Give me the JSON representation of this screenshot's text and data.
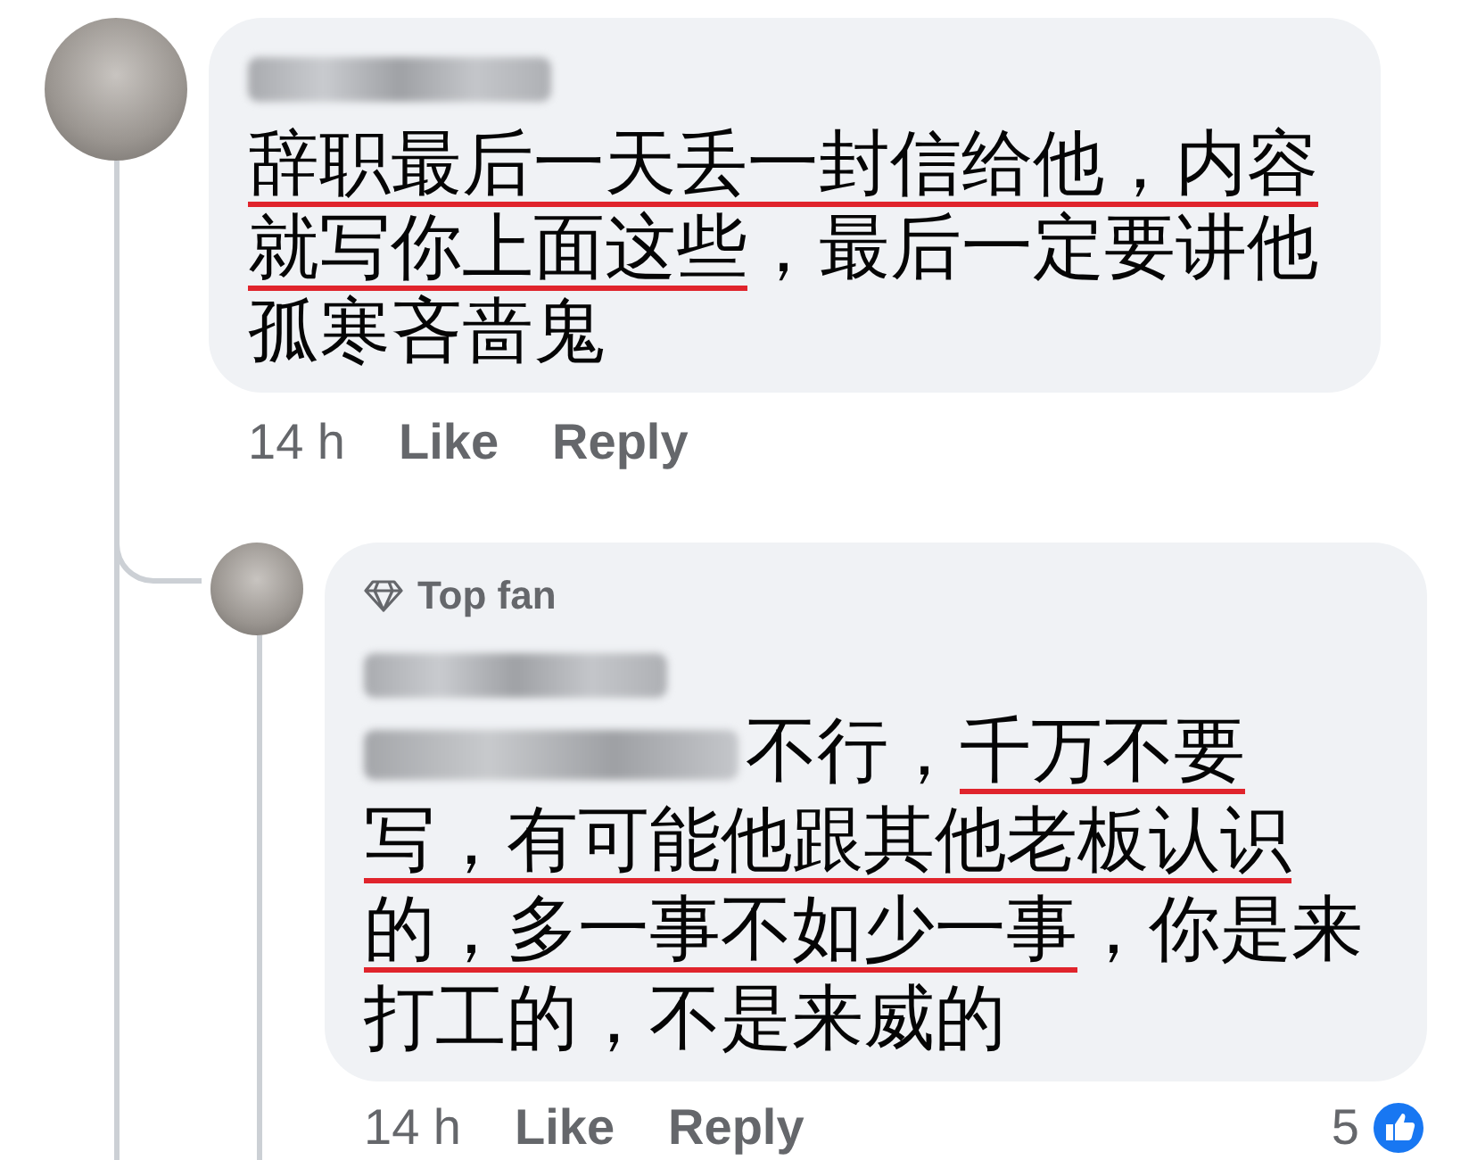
{
  "comment": {
    "lines": [
      [
        {
          "kind": "text",
          "text": "辞职最后一天丢一封信给他，内容",
          "underlined": true
        }
      ],
      [
        {
          "kind": "text",
          "text": "就写你上面这些",
          "underlined": true
        },
        {
          "kind": "text",
          "text": "，最后一定要讲他",
          "underlined": false
        }
      ],
      [
        {
          "kind": "text",
          "text": "孤寒吝啬鬼",
          "underlined": false
        }
      ]
    ],
    "time": "14 h",
    "actions": [
      "Like",
      "Reply"
    ],
    "reply": {
      "badge": "Top fan",
      "lines": [
        [
          {
            "kind": "mention"
          },
          {
            "kind": "text",
            "text": "不行，",
            "underlined": false
          },
          {
            "kind": "text",
            "text": "千万不要",
            "underlined": true
          }
        ],
        [
          {
            "kind": "text",
            "text": "写，有可能他跟其他老板认识",
            "underlined": true
          }
        ],
        [
          {
            "kind": "text",
            "text": "的，多一事不如少一事",
            "underlined": true
          },
          {
            "kind": "text",
            "text": "，你是来",
            "underlined": false
          }
        ],
        [
          {
            "kind": "text",
            "text": "打工的，不是来威的",
            "underlined": false
          }
        ]
      ],
      "time": "14 h",
      "actions": [
        "Like",
        "Reply"
      ],
      "reaction_count": "5"
    }
  }
}
